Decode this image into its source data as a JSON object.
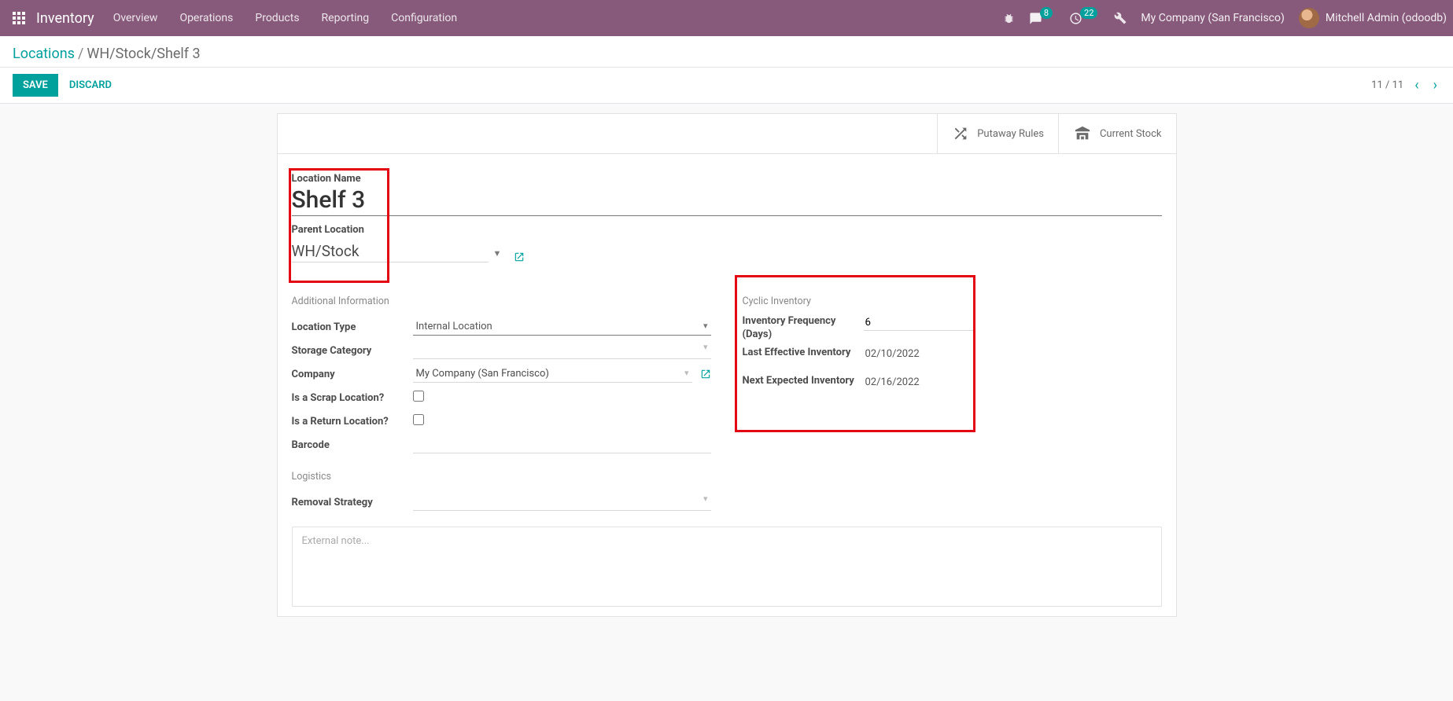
{
  "topbar": {
    "brand": "Inventory",
    "nav": [
      "Overview",
      "Operations",
      "Products",
      "Reporting",
      "Configuration"
    ],
    "msg_badge": "8",
    "act_badge": "22",
    "company": "My Company (San Francisco)",
    "user": "Mitchell Admin (odoodb)"
  },
  "breadcrumb": {
    "parent": "Locations",
    "current": "WH/Stock/Shelf 3"
  },
  "actions": {
    "save": "SAVE",
    "discard": "DISCARD",
    "pager": "11 / 11"
  },
  "buttons": {
    "putaway": "Putaway Rules",
    "stock": "Current Stock"
  },
  "form": {
    "location_name_label": "Location Name",
    "location_name": "Shelf 3",
    "parent_location_label": "Parent Location",
    "parent_location": "WH/Stock",
    "additional_info": "Additional Information",
    "location_type_label": "Location Type",
    "location_type": "Internal Location",
    "storage_category_label": "Storage Category",
    "company_label": "Company",
    "company": "My Company (San Francisco)",
    "scrap_label": "Is a Scrap Location?",
    "return_label": "Is a Return Location?",
    "barcode_label": "Barcode",
    "logistics": "Logistics",
    "removal_label": "Removal Strategy",
    "cyclic": "Cyclic Inventory",
    "freq_label": "Inventory Frequency (Days)",
    "freq": "6",
    "last_label": "Last Effective Inventory",
    "last": "02/10/2022",
    "next_label": "Next Expected Inventory",
    "next": "02/16/2022",
    "note_placeholder": "External note..."
  }
}
